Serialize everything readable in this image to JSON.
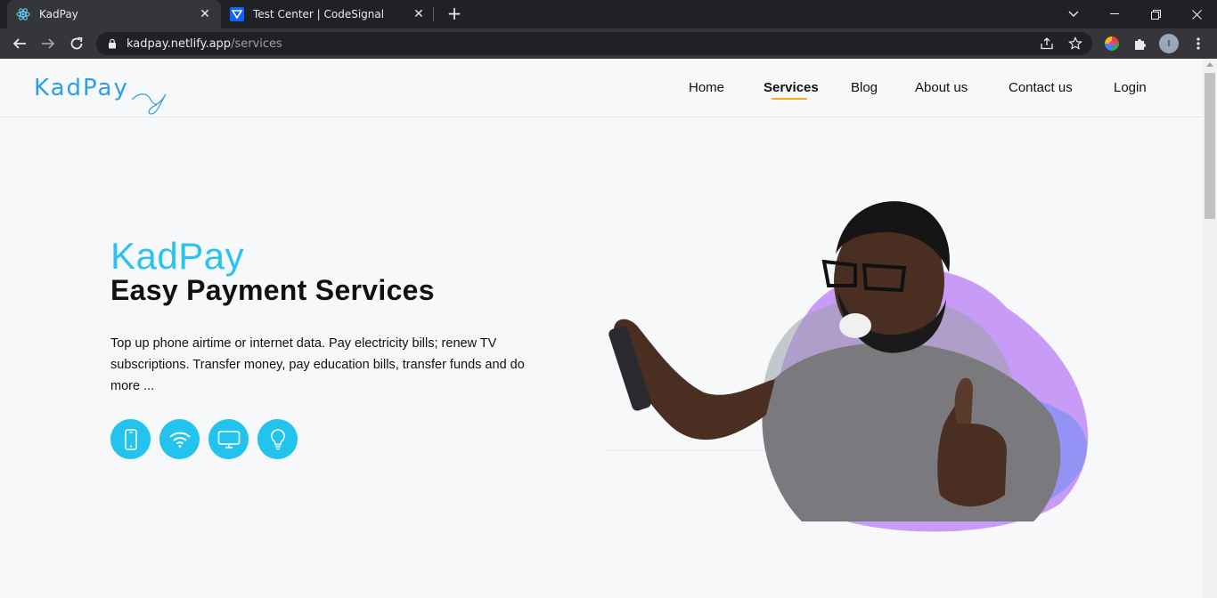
{
  "browser": {
    "tabs": [
      {
        "title": "KadPay",
        "active": true,
        "favicon": "react-icon"
      },
      {
        "title": "Test Center | CodeSignal",
        "active": false,
        "favicon": "codesignal-icon"
      }
    ],
    "url_host": "kadpay.netlify.app",
    "url_path": "/services",
    "profile_initial": "I"
  },
  "site": {
    "logo_text": "KadPay",
    "nav": [
      {
        "label": "Home",
        "active": false
      },
      {
        "label": "Services",
        "active": true
      },
      {
        "label": "Blog",
        "active": false
      },
      {
        "label": "About us",
        "active": false
      },
      {
        "label": "Contact us",
        "active": false
      },
      {
        "label": "Login",
        "active": false
      }
    ],
    "accent_color": "#2ac3ef",
    "nav_indicator_color": "#f5a623"
  },
  "hero": {
    "title": "KadPay",
    "subtitle": "Easy Payment Services",
    "description": "Top up phone airtime or internet data. Pay electricity bills; renew TV subscriptions. Transfer money, pay education bills, transfer funds and do more ...",
    "services": [
      {
        "icon": "mobile-phone-icon"
      },
      {
        "icon": "wifi-icon"
      },
      {
        "icon": "tv-icon"
      },
      {
        "icon": "lightbulb-icon"
      }
    ]
  }
}
